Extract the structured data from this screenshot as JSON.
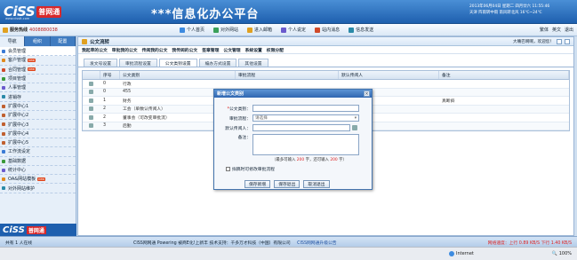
{
  "banner": {
    "logo_text": "CiSS",
    "logo_badge": "普网通",
    "logo_url": "www.cisstt.com",
    "app_title": "***信息化办公平台",
    "datetime_line1": "2013年06月04日 星期二 四月廿六 11:55:46",
    "datetime_line2": "天津 阵雨转中雨 南风转北风 16℃~24℃"
  },
  "topbar": {
    "hotline_label": "服务热线",
    "hotline_number": "4008880038",
    "links": [
      "个人首页",
      "对外网站",
      "进入邮箱",
      "个人说定",
      "站内消息",
      "信息发送"
    ],
    "lang_label": "繁体",
    "lang2_label": "英文",
    "exit_label": "退出"
  },
  "sidebar": {
    "tabs": [
      "导航",
      "组织",
      "配置"
    ],
    "items": [
      {
        "label": "会员管理",
        "new": false,
        "color": "#3a7bd5"
      },
      {
        "label": "客户管理",
        "new": true,
        "color": "#e08a1e"
      },
      {
        "label": "合同管理",
        "new": true,
        "color": "#d04a2a"
      },
      {
        "label": "项目管理",
        "new": false,
        "color": "#3a9a3a"
      },
      {
        "label": "人事管理",
        "new": false,
        "color": "#6a5acd"
      },
      {
        "label": "进销存",
        "new": false,
        "color": "#2a8aa8"
      },
      {
        "label": "扩展中心1",
        "new": false,
        "color": "#c06030"
      },
      {
        "label": "扩展中心2",
        "new": false,
        "color": "#c06030"
      },
      {
        "label": "扩展中心3",
        "new": false,
        "color": "#c06030"
      },
      {
        "label": "扩展中心4",
        "new": false,
        "color": "#c06030"
      },
      {
        "label": "扩展中心5",
        "new": false,
        "color": "#c06030"
      },
      {
        "label": "工作流设定",
        "new": false,
        "color": "#3a7bd5"
      },
      {
        "label": "基础数据",
        "new": false,
        "color": "#3a9a3a"
      },
      {
        "label": "统计中心",
        "new": false,
        "color": "#6a5acd"
      },
      {
        "label": "OA&网站模板",
        "new": true,
        "color": "#e08a1e"
      },
      {
        "label": "对外网站维护",
        "new": false,
        "color": "#2a8aa8"
      }
    ],
    "new_badge": "new",
    "logo_text": "CiSS",
    "logo_badge": "普网通"
  },
  "main": {
    "title": "公文流转",
    "welcome": "大嘴巴啊啊，欢迎您！",
    "subnav": [
      "我起草的公文",
      "审批我的公文",
      "传阅我的公文",
      "我传阅的公文",
      "签章管理",
      "公文管理",
      "系统设置",
      "权限分配"
    ],
    "tabs": [
      "发文号设置",
      "审批流程设置",
      "公文类别设置",
      "编办方式设置",
      "其他设置"
    ],
    "active_tab": 2,
    "columns": [
      "",
      "序号",
      "公文类别",
      "审批流程",
      "默认传阅人",
      "备注"
    ],
    "rows": [
      {
        "id": "0",
        "category": "行政",
        "flow": "",
        "reader": "",
        "note": ""
      },
      {
        "id": "0",
        "category": "455",
        "flow": "",
        "reader": "",
        "note": ""
      },
      {
        "id": "1",
        "category": "财务",
        "flow": "",
        "reader": "张三, 阿高",
        "note": "真断斜"
      },
      {
        "id": "2",
        "category": "工会（单数认传阅人）",
        "flow": "",
        "reader": "",
        "note": ""
      },
      {
        "id": "2",
        "category": "董事会（可改变审批流）",
        "flow": "",
        "reader": "",
        "note": ""
      },
      {
        "id": "3",
        "category": "后勤",
        "flow": "",
        "reader": "",
        "note": ""
      }
    ]
  },
  "modal": {
    "title": "新增公文类别",
    "close": "×",
    "field_category_label": "公文类别：",
    "field_category_value": "",
    "field_flow_label": "审批流程：",
    "field_flow_placeholder": "请选择",
    "field_reader_label": "默认传阅人：",
    "field_note_label": "备注：",
    "note_text_prefix": "（最多可输入",
    "note_max": "200",
    "note_text_mid": "字，还可输入",
    "note_left": "200",
    "note_text_suffix": "字）",
    "checkbox_label": "拟稿时可修改审批流程",
    "btn_save_new": "保存新增",
    "btn_save_exit": "保存退出",
    "btn_cancel": "取消退出"
  },
  "footer": {
    "online": "共有 1 人在线",
    "powered": "CISS网网通 Powering  被商E化!上新丰  技术支持：千多万才科技（中国）有限公司",
    "notice_link": "CISS网网通升级公告",
    "speed": "网络速度：上行 0.89 KB/S  下行 1.40 KB/S"
  },
  "statusbar": {
    "zone": "Internet",
    "zoom": "100%"
  }
}
